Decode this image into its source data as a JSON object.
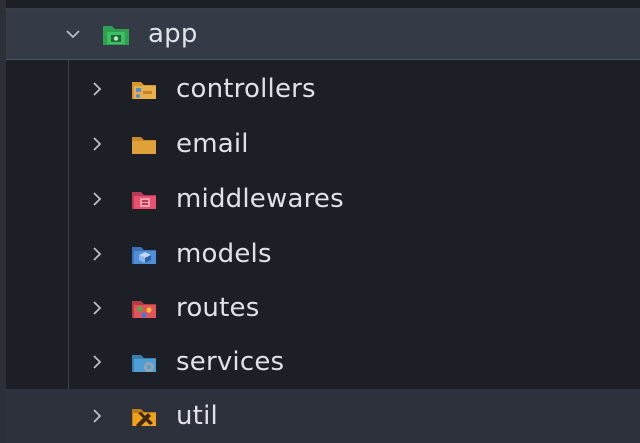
{
  "explorer": {
    "root": {
      "label": "app",
      "expanded": true,
      "icon": "folder-app-icon",
      "icon_color": "#2e9e4f"
    },
    "items": [
      {
        "label": "controllers",
        "icon": "folder-controllers-icon",
        "color": "#e8a33d"
      },
      {
        "label": "email",
        "icon": "folder-email-icon",
        "color": "#e0a03a"
      },
      {
        "label": "middlewares",
        "icon": "folder-middlewares-icon",
        "color": "#e8506e"
      },
      {
        "label": "models",
        "icon": "folder-models-icon",
        "color": "#4f8fd9"
      },
      {
        "label": "routes",
        "icon": "folder-routes-icon",
        "color": "#e2545a"
      },
      {
        "label": "services",
        "icon": "folder-services-icon",
        "color": "#4e9fd6"
      },
      {
        "label": "util",
        "icon": "folder-util-icon",
        "color": "#f0a21e"
      }
    ],
    "colors": {
      "background": "#1c1f25",
      "root_row": "#343a46",
      "hover_row": "#2c313c",
      "text": "#dfe2e8"
    }
  }
}
